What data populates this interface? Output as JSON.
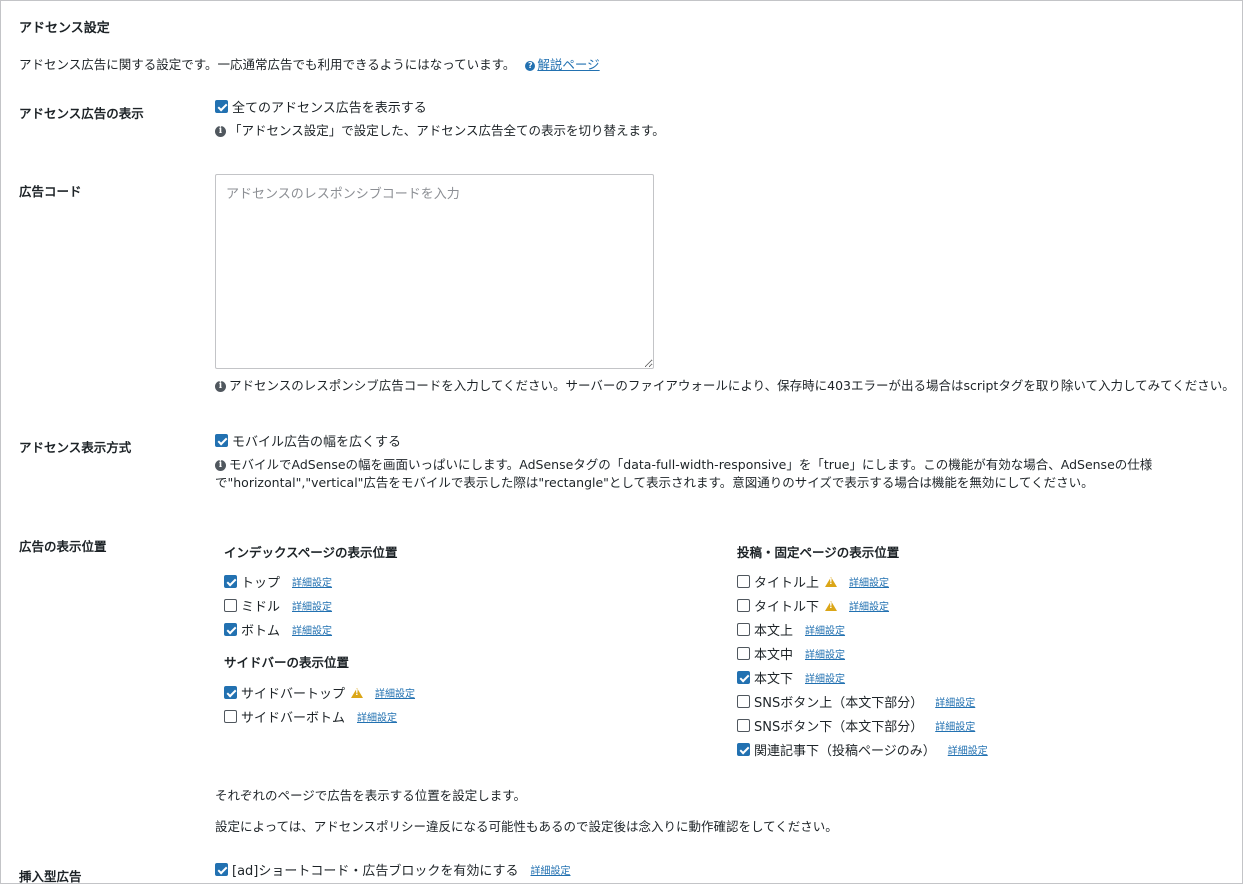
{
  "section": {
    "title": "アドセンス設定",
    "intro": "アドセンス広告に関する設定です。一応通常広告でも利用できるようにはなっています。",
    "help_icon": "question-circle-icon",
    "help_link": "解説ページ"
  },
  "display": {
    "label": "アドセンス広告の表示",
    "checkbox_label": "全てのアドセンス広告を表示する",
    "checked": true,
    "note": "「アドセンス設定」で設定した、アドセンス広告全ての表示を切り替えます。"
  },
  "code": {
    "label": "広告コード",
    "placeholder": "アドセンスのレスポンシブコードを入力",
    "value": "",
    "note": "アドセンスのレスポンシブ広告コードを入力してください。サーバーのファイアウォールにより、保存時に403エラーが出る場合はscriptタグを取り除いて入力してみてください。"
  },
  "mode": {
    "label": "アドセンス表示方式",
    "checkbox_label": "モバイル広告の幅を広くする",
    "checked": true,
    "note_line1": "モバイルでAdSenseの幅を画面いっぱいにします。AdSenseタグの「data-full-width-responsive」を「true」にします。この機能が有効な場合、AdSenseの仕様",
    "note_line2": "で\"horizontal\",\"vertical\"広告をモバイルで表示した際は\"rectangle\"として表示されます。意図通りのサイズで表示する場合は機能を無効にしてください。"
  },
  "position": {
    "label": "広告の表示位置",
    "detail_link": "詳細設定",
    "index_heading": "インデックスページの表示位置",
    "index_items": [
      {
        "label": "トップ",
        "checked": true,
        "warning": false
      },
      {
        "label": "ミドル",
        "checked": false,
        "warning": false
      },
      {
        "label": "ボトム",
        "checked": true,
        "warning": false
      }
    ],
    "sidebar_heading": "サイドバーの表示位置",
    "sidebar_items": [
      {
        "label": "サイドバートップ",
        "checked": true,
        "warning": true
      },
      {
        "label": "サイドバーボトム",
        "checked": false,
        "warning": false
      }
    ],
    "post_heading": "投稿・固定ページの表示位置",
    "post_items": [
      {
        "label": "タイトル上",
        "checked": false,
        "warning": true
      },
      {
        "label": "タイトル下",
        "checked": false,
        "warning": true
      },
      {
        "label": "本文上",
        "checked": false,
        "warning": false
      },
      {
        "label": "本文中",
        "checked": false,
        "warning": false
      },
      {
        "label": "本文下",
        "checked": true,
        "warning": false
      },
      {
        "label": "SNSボタン上（本文下部分）",
        "checked": false,
        "warning": false
      },
      {
        "label": "SNSボタン下（本文下部分）",
        "checked": false,
        "warning": false
      },
      {
        "label": "関連記事下（投稿ページのみ）",
        "checked": true,
        "warning": false
      }
    ],
    "note1": "それぞれのページで広告を表示する位置を設定します。",
    "note2": "設定によっては、アドセンスポリシー違反になる可能性もあるので設定後は念入りに動作確認をしてください。"
  },
  "insert": {
    "label": "挿入型広告",
    "checkbox_label": "[ad]ショートコード・広告ブロックを有効にする",
    "checked": true,
    "detail_link": "詳細設定"
  },
  "icons": {
    "info": "info-circle-icon",
    "warning": "warning-triangle-icon",
    "resize": "resize-handle-icon"
  },
  "colors": {
    "link": "#2271b1",
    "checkbox_checked": "#2271b1",
    "warning": "#dba617",
    "border": "#c3c4c7"
  }
}
